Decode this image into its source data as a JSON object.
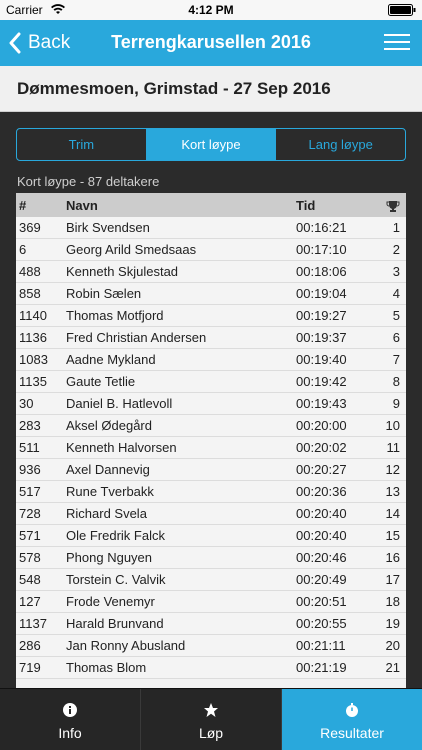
{
  "status_bar": {
    "carrier": "Carrier",
    "time": "4:12 PM"
  },
  "navbar": {
    "back_label": "Back",
    "title": "Terrengkarusellen 2016"
  },
  "event": {
    "title": "Dømmesmoen, Grimstad - 27 Sep 2016"
  },
  "segments": [
    {
      "label": "Trim",
      "active": false
    },
    {
      "label": "Kort løype",
      "active": true
    },
    {
      "label": "Lang løype",
      "active": false
    }
  ],
  "subtitle": "Kort løype - 87 deltakere",
  "table": {
    "headers": {
      "num": "#",
      "name": "Navn",
      "time": "Tid"
    },
    "rows": [
      {
        "num": "369",
        "name": "Birk Svendsen",
        "time": "00:16:21",
        "place": "1"
      },
      {
        "num": "6",
        "name": "Georg Arild Smedsaas",
        "time": "00:17:10",
        "place": "2"
      },
      {
        "num": "488",
        "name": "Kenneth Skjulestad",
        "time": "00:18:06",
        "place": "3"
      },
      {
        "num": "858",
        "name": "Robin Sælen",
        "time": "00:19:04",
        "place": "4"
      },
      {
        "num": "1140",
        "name": "Thomas Motfjord",
        "time": "00:19:27",
        "place": "5"
      },
      {
        "num": "1136",
        "name": "Fred Christian Andersen",
        "time": "00:19:37",
        "place": "6"
      },
      {
        "num": "1083",
        "name": "Aadne Mykland",
        "time": "00:19:40",
        "place": "7"
      },
      {
        "num": "1135",
        "name": "Gaute Tetlie",
        "time": "00:19:42",
        "place": "8"
      },
      {
        "num": "30",
        "name": "Daniel B. Hatlevoll",
        "time": "00:19:43",
        "place": "9"
      },
      {
        "num": "283",
        "name": "Aksel Ødegård",
        "time": "00:20:00",
        "place": "10"
      },
      {
        "num": "511",
        "name": "Kenneth Halvorsen",
        "time": "00:20:02",
        "place": "11"
      },
      {
        "num": "936",
        "name": "Axel Dannevig",
        "time": "00:20:27",
        "place": "12"
      },
      {
        "num": "517",
        "name": "Rune Tverbakk",
        "time": "00:20:36",
        "place": "13"
      },
      {
        "num": "728",
        "name": "Richard Svela",
        "time": "00:20:40",
        "place": "14"
      },
      {
        "num": "571",
        "name": "Ole Fredrik Falck",
        "time": "00:20:40",
        "place": "15"
      },
      {
        "num": "578",
        "name": "Phong Nguyen",
        "time": "00:20:46",
        "place": "16"
      },
      {
        "num": "548",
        "name": "Torstein C. Valvik",
        "time": "00:20:49",
        "place": "17"
      },
      {
        "num": "127",
        "name": "Frode Venemyr",
        "time": "00:20:51",
        "place": "18"
      },
      {
        "num": "1137",
        "name": "Harald Brunvand",
        "time": "00:20:55",
        "place": "19"
      },
      {
        "num": "286",
        "name": "Jan Ronny Abusland",
        "time": "00:21:11",
        "place": "20"
      },
      {
        "num": "719",
        "name": "Thomas Blom",
        "time": "00:21:19",
        "place": "21"
      }
    ]
  },
  "tabs": [
    {
      "label": "Info",
      "icon": "info-icon",
      "active": false
    },
    {
      "label": "Løp",
      "icon": "star-icon",
      "active": false
    },
    {
      "label": "Resultater",
      "icon": "stopwatch-icon",
      "active": true
    }
  ],
  "colors": {
    "accent": "#29a8dc",
    "background": "#2b2b2b"
  }
}
